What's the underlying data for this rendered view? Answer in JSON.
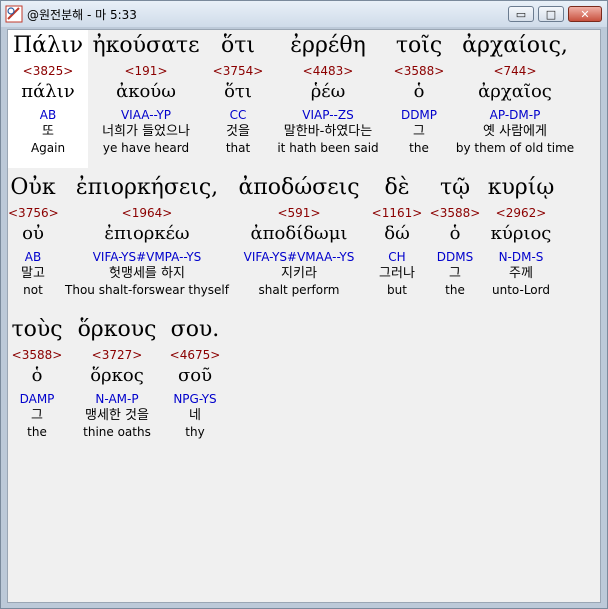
{
  "window": {
    "title": "@원전분해 - 마 5:33"
  },
  "controls": {
    "minimize": "▭",
    "maximize": "□",
    "close": "✕"
  },
  "rows": [
    [
      {
        "greek": "Πάλιν",
        "strong": "<3825>",
        "lemma": "πάλιν",
        "parse": "AB",
        "korean": "또",
        "english": "Again"
      },
      {
        "greek": "ἠκούσατε",
        "strong": "<191>",
        "lemma": "ἀκούω",
        "parse": "VIAA--YP",
        "korean": "너희가 들었으나",
        "english": "ye have heard"
      },
      {
        "greek": "ὅτι",
        "strong": "<3754>",
        "lemma": "ὅτι",
        "parse": "CC",
        "korean": "것을",
        "english": "that"
      },
      {
        "greek": "ἐρρέθη",
        "strong": "<4483>",
        "lemma": "ῥέω",
        "parse": "VIAP--ZS",
        "korean": "말한바-하였다는",
        "english": "it hath been said"
      },
      {
        "greek": "τοῖς",
        "strong": "<3588>",
        "lemma": "ὁ",
        "parse": "DDMP",
        "korean": "그",
        "english": "the"
      },
      {
        "greek": "ἀρχαίοις,",
        "strong": "<744>",
        "lemma": "ἀρχαῖος",
        "parse": "AP-DM-P",
        "korean": "옛 사람에게",
        "english": "by them of old time"
      }
    ],
    [
      {
        "greek": "Οὐκ",
        "strong": "<3756>",
        "lemma": "οὐ",
        "parse": "AB",
        "korean": "말고",
        "english": "not"
      },
      {
        "greek": "ἐπιορκήσεις,",
        "strong": "<1964>",
        "lemma": "ἐπιορκέω",
        "parse": "VIFA-YS#VMPA--YS",
        "korean": "헛맹세를 하지",
        "english": "Thou shalt-forswear thyself"
      },
      {
        "greek": "ἀποδώσεις",
        "strong": "<591>",
        "lemma": "ἀποδίδωμι",
        "parse": "VIFA-YS#VMAA--YS",
        "korean": "지키라",
        "english": "shalt perform"
      },
      {
        "greek": "δὲ",
        "strong": "<1161>",
        "lemma": "δώ",
        "parse": "CH",
        "korean": "그러나",
        "english": "but"
      },
      {
        "greek": "τῷ",
        "strong": "<3588>",
        "lemma": "ὁ",
        "parse": "DDMS",
        "korean": "그",
        "english": "the"
      },
      {
        "greek": "κυρίῳ",
        "strong": "<2962>",
        "lemma": "κύριος",
        "parse": "N-DM-S",
        "korean": "주께",
        "english": "unto-Lord"
      }
    ],
    [
      {
        "greek": "τοὺς",
        "strong": "<3588>",
        "lemma": "ὁ",
        "parse": "DAMP",
        "korean": "그",
        "english": "the"
      },
      {
        "greek": "ὅρκους",
        "strong": "<3727>",
        "lemma": "ὅρκος",
        "parse": "N-AM-P",
        "korean": "맹세한 것을",
        "english": "thine oaths"
      },
      {
        "greek": "σου.",
        "strong": "<4675>",
        "lemma": "σοῦ",
        "parse": "NPG-YS",
        "korean": "네",
        "english": "thy"
      }
    ]
  ]
}
